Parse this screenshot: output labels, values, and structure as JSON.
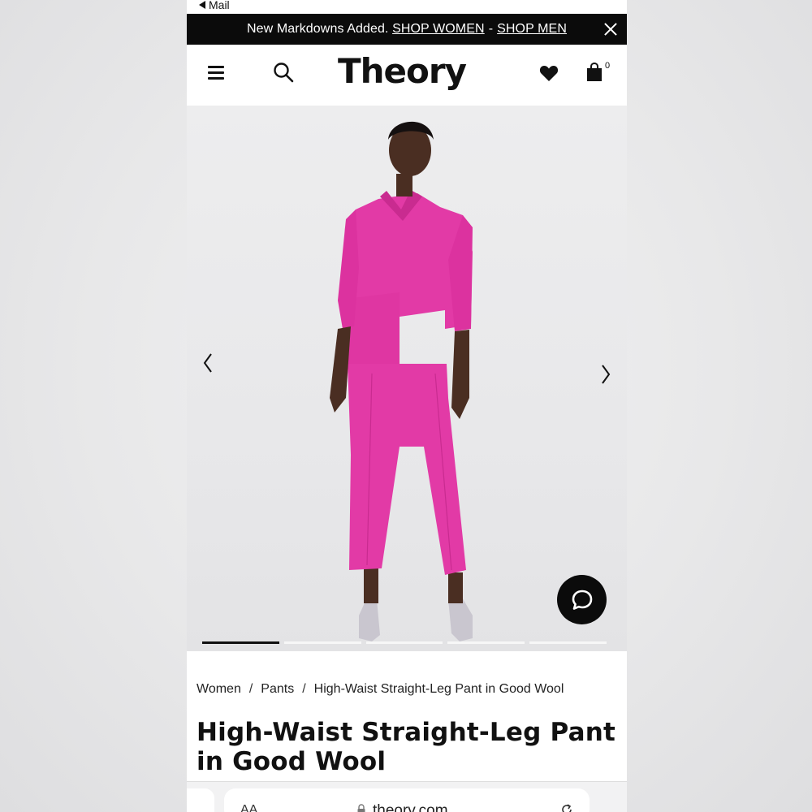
{
  "status_bar": {
    "back_label": "Mail"
  },
  "promo_banner": {
    "text": "New Markdowns Added.",
    "shop_women": "SHOP WOMEN",
    "separator": "-",
    "shop_men": "SHOP MEN"
  },
  "header": {
    "logo": "Theory",
    "bag_count": "0"
  },
  "gallery": {
    "total_images": 5,
    "active_index": 0,
    "product_color": "#e23aa6"
  },
  "breadcrumb": {
    "items": [
      "Women",
      "Pants",
      "High-Waist Straight-Leg Pant in Good Wool"
    ],
    "separator": "/"
  },
  "product": {
    "title": "High-Waist Straight-Leg Pant in Good Wool"
  },
  "browser": {
    "aa_label": "AA",
    "url": "theory.com"
  },
  "colors": {
    "banner_bg": "#0b0b0b",
    "accent_pink": "#e23aa6"
  }
}
